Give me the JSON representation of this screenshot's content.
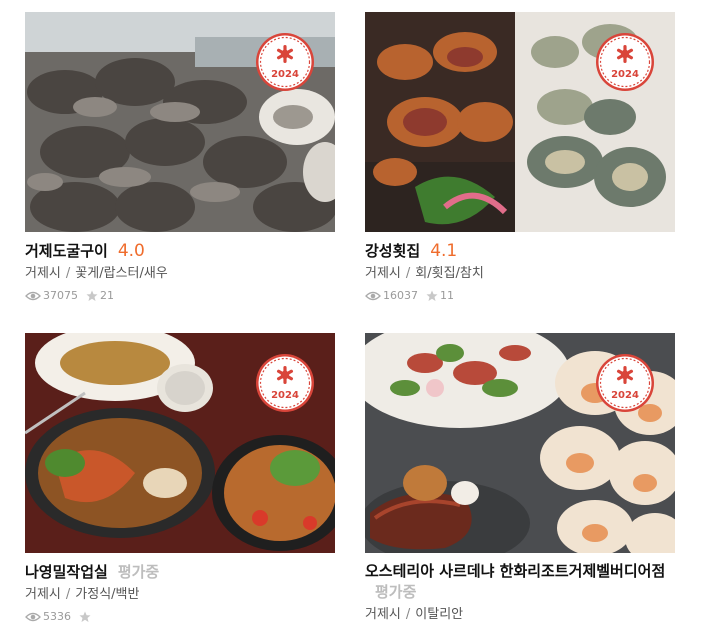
{
  "colors": {
    "accent": "#ef6c2c",
    "badge": "#d9453a",
    "pending": "#bdbdbd"
  },
  "restaurants": [
    {
      "name": "거제도굴구이",
      "score": "4.0",
      "location": "거제시",
      "category": "꽃게/랍스터/새우",
      "views": "37075",
      "favorites": "21",
      "badge_year": "2024"
    },
    {
      "name": "강성횟집",
      "score": "4.1",
      "location": "거제시",
      "category": "회/횟집/참치",
      "views": "16037",
      "favorites": "11",
      "badge_year": "2024"
    },
    {
      "name": "나영밀작업실",
      "score": "평가중",
      "location": "거제시",
      "category": "가정식/백반",
      "views": "5336",
      "favorites": "",
      "badge_year": "2024"
    },
    {
      "name": "오스테리아 사르데냐 한화리조트거제벨버디어점",
      "score": "평가중",
      "location": "거제시",
      "category": "이탈리안",
      "badge_year": "2024"
    }
  ]
}
